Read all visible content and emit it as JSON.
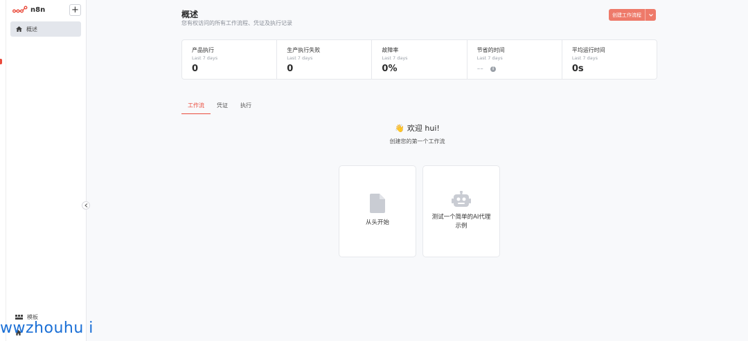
{
  "app": {
    "name": "n8n",
    "add_label": "+"
  },
  "sidebar": {
    "items": [
      {
        "label": "概述",
        "icon": "home-icon"
      }
    ],
    "bottom_items": [
      {
        "label": "模板",
        "icon": "templates-icon"
      },
      {
        "label": "",
        "icon": "home-icon"
      }
    ]
  },
  "header": {
    "title": "概述",
    "subtitle": "您有权访问的所有工作流程、凭证及执行记录",
    "create_button": "创建工作流程"
  },
  "stats": [
    {
      "label": "产品执行",
      "period": "Last 7 days",
      "value": "0"
    },
    {
      "label": "生产执行失败",
      "period": "Last 7 days",
      "value": "0"
    },
    {
      "label": "故障率",
      "period": "Last 7 days",
      "value": "0%"
    },
    {
      "label": "节省的时间",
      "period": "Last 7 days",
      "value": "--"
    },
    {
      "label": "平均运行时间",
      "period": "Last 7 days",
      "value": "0s"
    }
  ],
  "tabs": [
    {
      "label": "工作流"
    },
    {
      "label": "凭证"
    },
    {
      "label": "执行"
    }
  ],
  "welcome": {
    "emoji": "👋",
    "title": "欢迎 hui!",
    "subtitle": "创建您的第一个工作流"
  },
  "cards": [
    {
      "label": "从头开始"
    },
    {
      "label": "测试一个简单的AI代理示例"
    }
  ],
  "watermark": "wwzhouhu i",
  "colors": {
    "accent": "#ea4b3c",
    "button": "#ee7a6a"
  }
}
